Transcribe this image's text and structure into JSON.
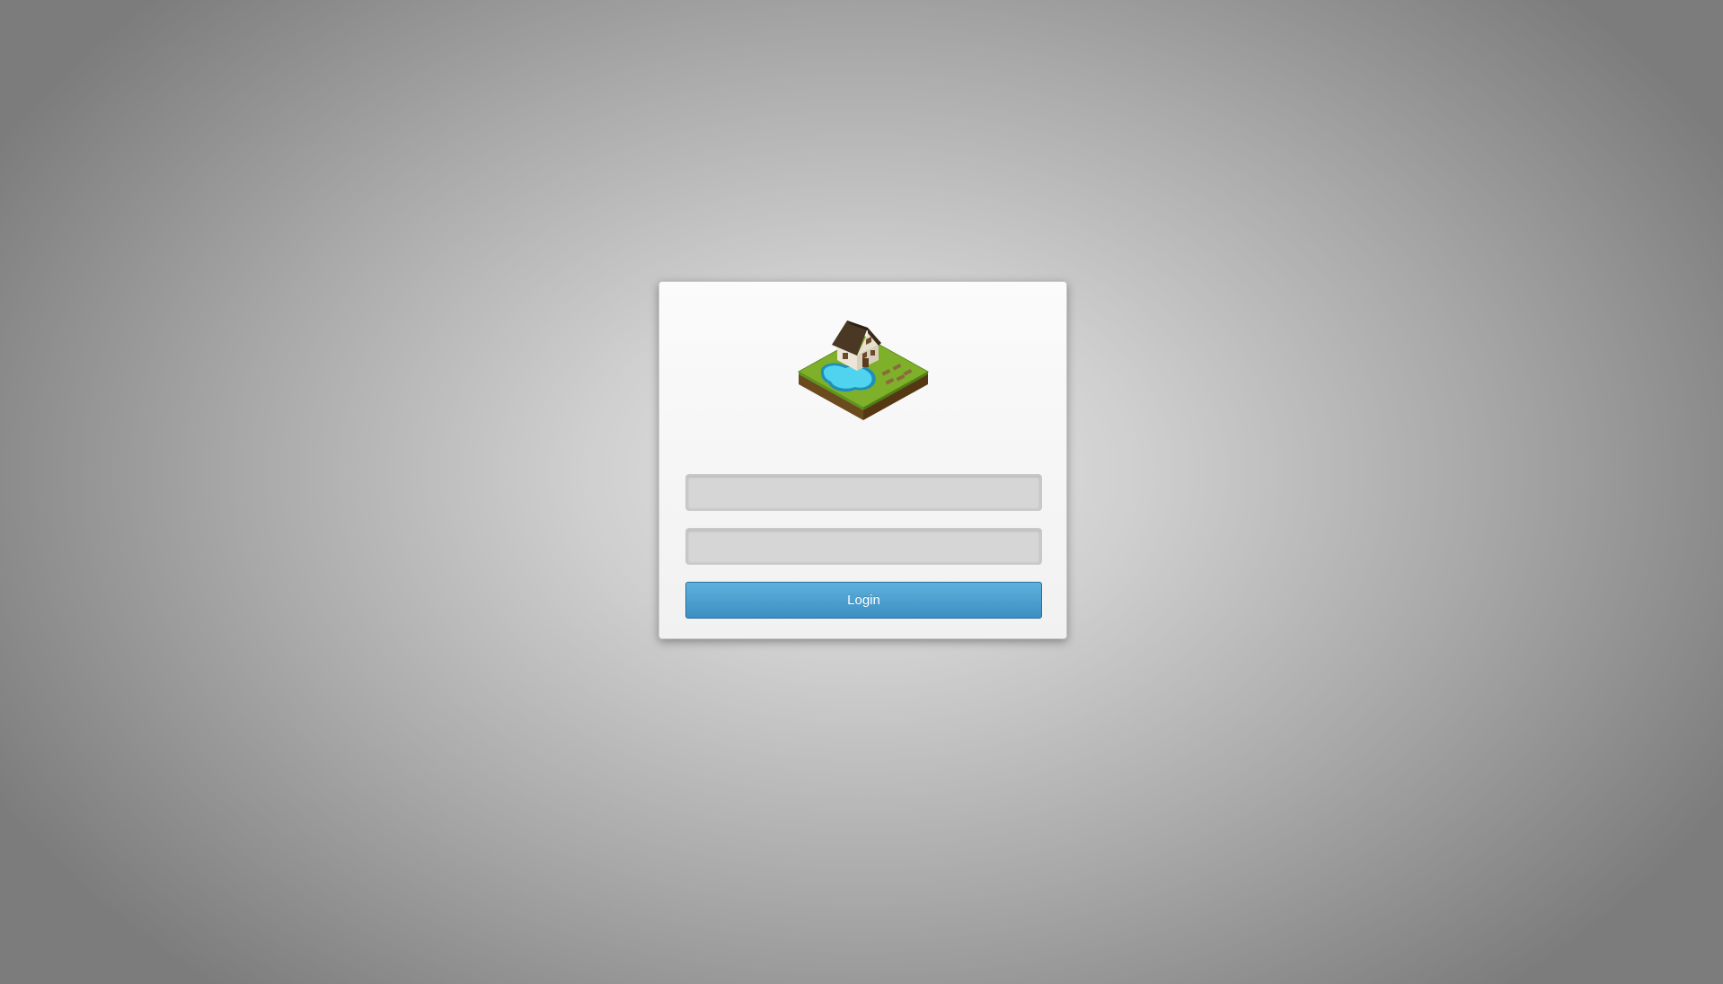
{
  "login": {
    "logo_icon": "house-with-pool-icon",
    "username_placeholder": "",
    "password_placeholder": "",
    "button_label": "Login"
  },
  "colors": {
    "button": "#4aa0d0",
    "field_background": "#d6d6d6"
  }
}
